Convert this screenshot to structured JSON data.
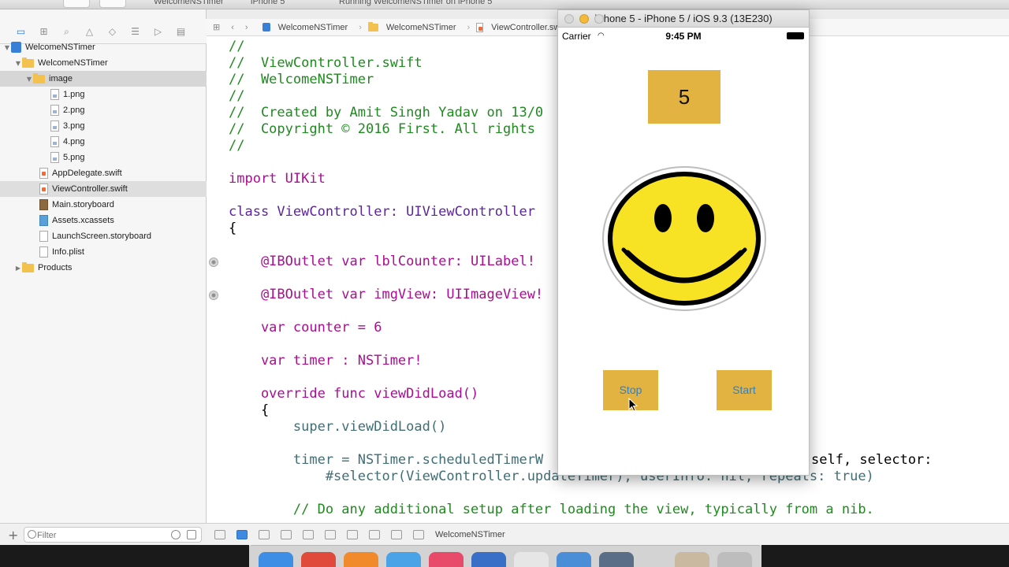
{
  "toolbar": {
    "scheme": "WelcomeNSTimer",
    "device": "iPhone 5",
    "status": "Running WelcomeNSTimer on iPhone 5"
  },
  "navigator": {
    "items": [
      {
        "label": "WelcomeNSTimer",
        "icon": "project-icon"
      },
      {
        "label": "WelcomeNSTimer",
        "icon": "folder-icon"
      },
      {
        "label": "image",
        "icon": "folder-icon"
      },
      {
        "label": "1.png",
        "icon": "png-file-icon"
      },
      {
        "label": "2.png",
        "icon": "png-file-icon"
      },
      {
        "label": "3.png",
        "icon": "png-file-icon"
      },
      {
        "label": "4.png",
        "icon": "png-file-icon"
      },
      {
        "label": "5.png",
        "icon": "png-file-icon"
      },
      {
        "label": "AppDelegate.swift",
        "icon": "swift-file-icon"
      },
      {
        "label": "ViewController.swift",
        "icon": "swift-file-icon"
      },
      {
        "label": "Main.storyboard",
        "icon": "storyboard-file-icon"
      },
      {
        "label": "Assets.xcassets",
        "icon": "assets-icon"
      },
      {
        "label": "LaunchScreen.storyboard",
        "icon": "storyboard-file-icon"
      },
      {
        "label": "Info.plist",
        "icon": "plist-file-icon"
      },
      {
        "label": "Products",
        "icon": "folder-icon"
      }
    ],
    "filter_placeholder": "Filter"
  },
  "jumpbar": {
    "crumbs": [
      "WelcomeNSTimer",
      "WelcomeNSTimer",
      "ViewController.swift"
    ]
  },
  "code": {
    "lines": [
      "//",
      "//  ViewController.swift",
      "//  WelcomeNSTimer",
      "//",
      "//  Created by Amit Singh Yadav on 13/0",
      "//  Copyright © 2016 First. All rights",
      "//",
      "",
      "import UIKit",
      "",
      "class ViewController: UIViewController",
      "{",
      "",
      "    @IBOutlet var lblCounter: UILabel!",
      "",
      "    @IBOutlet var imgView: UIImageView!",
      "",
      "    var counter = 6",
      "",
      "    var timer : NSTimer!",
      "",
      "    override func viewDidLoad()",
      "    {",
      "        super.viewDidLoad()",
      "",
      "        timer = NSTimer.scheduledTimerW",
      "            #selector(ViewController.updateTimer), userInfo: nil, repeats: true)",
      "",
      "        // Do any additional setup after loading the view, typically from a nib."
    ],
    "overflow_text": "self, selector:"
  },
  "debugbar": {
    "target": "WelcomeNSTimer"
  },
  "simulator": {
    "title": "iPhone 5 - iPhone 5 / iOS 9.3 (13E230)",
    "carrier": "Carrier",
    "time": "9:45 PM",
    "counter_value": "5",
    "stop_label": "Stop",
    "start_label": "Start",
    "accent": "#e3b341",
    "button_text_color": "#2a7fd0"
  }
}
